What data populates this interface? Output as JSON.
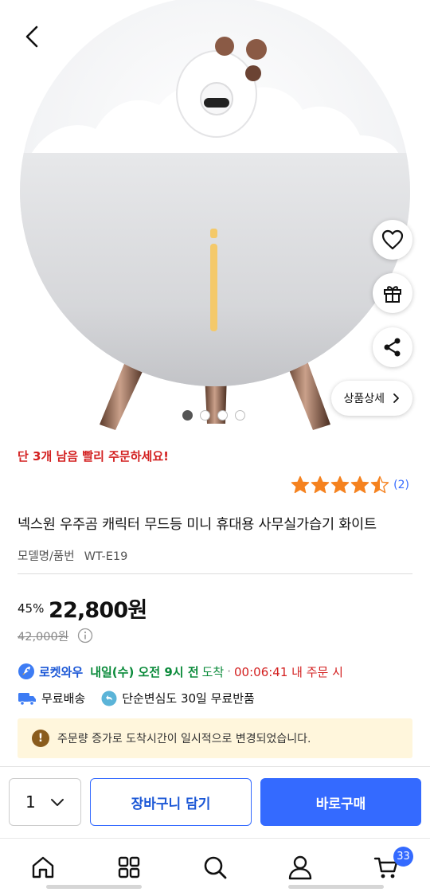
{
  "gallery": {
    "dot_count": 4,
    "active_index": 0,
    "detail_label": "상품상세"
  },
  "stock_notice": "단 3개 남음 빨리 주문하세요!",
  "rating": {
    "stars": 4.5,
    "count_label": "(2)",
    "star_color": "#f5821f"
  },
  "product": {
    "title": "넥스원 우주곰 캐릭터 무드등 미니 휴대용 사무실가습기 화이트",
    "model_label": "모델명/품번",
    "model_value": "WT-E19"
  },
  "price": {
    "discount": "45%",
    "sale": "22,800원",
    "original": "42,000원"
  },
  "delivery": {
    "brand": "로켓와우",
    "when": "내일(수) 오전 9시 전",
    "arrive": "도착",
    "separator": "·",
    "countdown": "00:06:41 내 주문 시",
    "free_shipping": "무료배송",
    "free_return": "단순변심도 30일 무료반품"
  },
  "notice": {
    "icon_text": "!",
    "text": "주문량 증가로 도착시간이 일시적으로 변경되었습니다."
  },
  "buy_bar": {
    "quantity": "1",
    "cart_label": "장바구니 담기",
    "buy_label": "바로구매",
    "accent": "#346aff"
  },
  "nav": {
    "cart_badge": "33"
  }
}
